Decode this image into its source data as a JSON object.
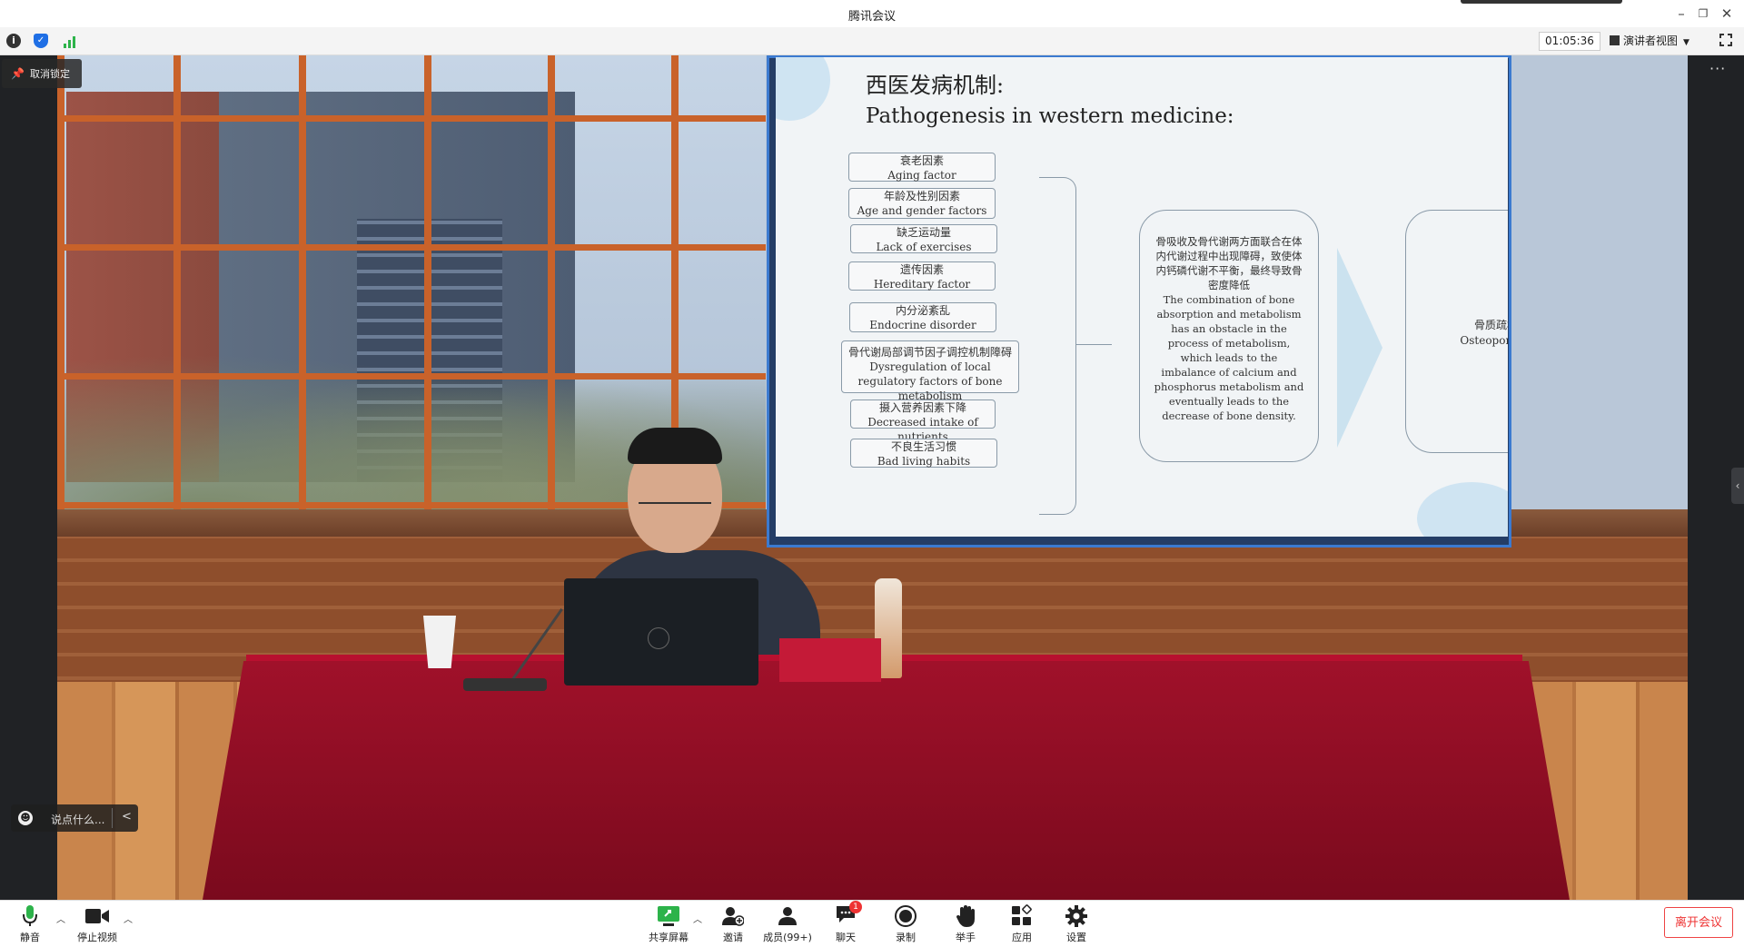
{
  "window": {
    "title": "腾讯会议"
  },
  "toolbar": {
    "timer": "01:05:36",
    "view_label": "演讲者视图"
  },
  "overlay": {
    "unpin_label": "取消锁定",
    "chat_placeholder": "说点什么..."
  },
  "slide": {
    "title_cn": "西医发病机制:",
    "title_en": "Pathogenesis in western medicine:",
    "factors": [
      {
        "cn": "衰老因素",
        "en": "Aging factor"
      },
      {
        "cn": "年龄及性别因素",
        "en": "Age and gender factors"
      },
      {
        "cn": "缺乏运动量",
        "en": "Lack of exercises"
      },
      {
        "cn": "遗传因素",
        "en": "Hereditary factor"
      },
      {
        "cn": "内分泌紊乱",
        "en": "Endocrine disorder"
      },
      {
        "cn": "骨代谢局部调节因子调控机制障碍",
        "en": "Dysregulation of local regulatory factors of bone metabolism"
      },
      {
        "cn": "摄入营养因素下降",
        "en": "Decreased intake of nutrients"
      },
      {
        "cn": "不良生活习惯",
        "en": "Bad living habits"
      }
    ],
    "mechanism_cn": "骨吸收及骨代谢两方面联合在体内代谢过程中出现障碍，致使体内钙磷代谢不平衡，最终导致骨密度降低",
    "mechanism_en": "The combination of bone absorption and metabolism has an obstacle in the process of metabolism, which leads to the imbalance of calcium and phosphorus metabolism and eventually leads to the decrease of bone density.",
    "result_cn": "骨质疏松",
    "result_en": "Osteoporosis"
  },
  "bottombar": {
    "mute": "静音",
    "stop_video": "停止视频",
    "share_screen": "共享屏幕",
    "invite": "邀请",
    "members": "成员(99+)",
    "chat": "聊天",
    "chat_badge": "1",
    "record": "录制",
    "raise_hand": "举手",
    "apps": "应用",
    "settings": "设置",
    "leave": "离开会议"
  },
  "colors": {
    "accent": "#1f6fe5",
    "leave": "#e33333",
    "signal": "#2db34a"
  }
}
